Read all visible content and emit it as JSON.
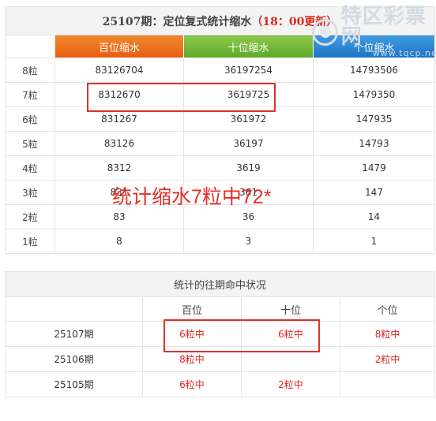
{
  "main_table": {
    "title_prefix": "25107期：定位复式统计缩水",
    "title_update": "（18：00更新）",
    "headers": [
      "百位缩水",
      "十位缩水",
      "个位缩水"
    ],
    "rows": [
      {
        "label": "8粒",
        "bai": "83126704",
        "shi": "36197254",
        "ge": "14793506"
      },
      {
        "label": "7粒",
        "bai": "8312670",
        "shi": "3619725",
        "ge": "1479350"
      },
      {
        "label": "6粒",
        "bai": "831267",
        "shi": "361972",
        "ge": "147935"
      },
      {
        "label": "5粒",
        "bai": "83126",
        "shi": "36197",
        "ge": "14793"
      },
      {
        "label": "4粒",
        "bai": "8312",
        "shi": "3619",
        "ge": "1479"
      },
      {
        "label": "3粒",
        "bai": "831",
        "shi": "361",
        "ge": "147"
      },
      {
        "label": "2粒",
        "bai": "83",
        "shi": "36",
        "ge": "14"
      },
      {
        "label": "1粒",
        "bai": "8",
        "shi": "3",
        "ge": "1"
      }
    ]
  },
  "history_table": {
    "title": "统计的往期命中状况",
    "headers": [
      "百位",
      "十位",
      "个位"
    ],
    "rows": [
      {
        "period": "25107期",
        "bai": "6粒中",
        "shi": "6粒中",
        "ge": "8粒中"
      },
      {
        "period": "25106期",
        "bai": "8粒中",
        "shi": "",
        "ge": "2粒中"
      },
      {
        "period": "25105期",
        "bai": "6粒中",
        "shi": "2粒中",
        "ge": ""
      }
    ]
  },
  "annotation": {
    "text": "统计缩水7粒中72*",
    "color": "#e0302a"
  },
  "watermark": {
    "brand": "特区彩票网",
    "url": "www.tqcp.net"
  },
  "colors": {
    "bai_header": "#e85b10",
    "shi_header": "#5fa82a",
    "ge_header": "#1c74c4",
    "hit_red": "#e02020"
  }
}
